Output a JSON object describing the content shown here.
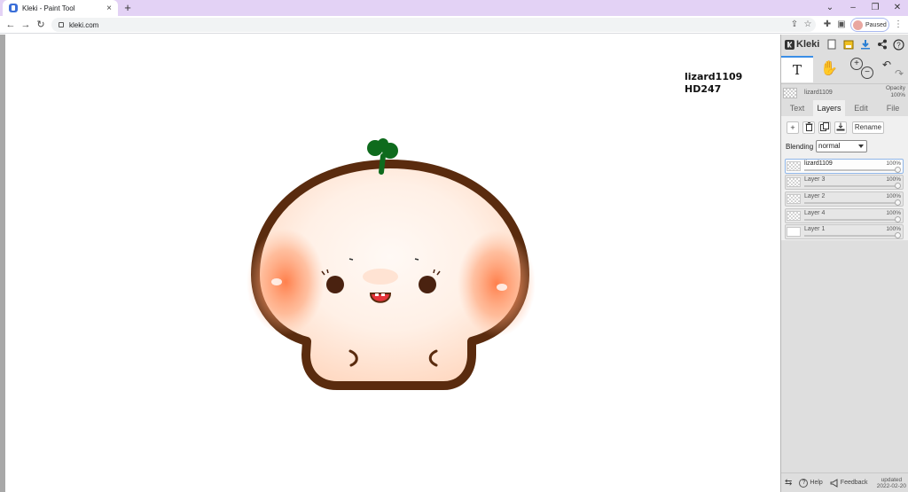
{
  "browser": {
    "tab_title": "Kleki - Paint Tool",
    "tab_close": "×",
    "new_tab": "+",
    "url": "kleki.com",
    "profile_status": "Paused",
    "window_controls": {
      "collapse": "⌄",
      "minimize": "–",
      "restore": "❐",
      "close": "✕"
    },
    "nav": {
      "back": "←",
      "forward": "→",
      "reload": "↻"
    },
    "address_icons": {
      "share": "⇪",
      "bookmark": "☆",
      "extensions": "✚",
      "sidepanel": "▣",
      "menu": "⋮"
    }
  },
  "canvas": {
    "signature_line1": "lizard1109",
    "signature_line2": "HD247"
  },
  "kleki": {
    "logo": "Kleki",
    "top_icons": {
      "new": "new-image-icon",
      "save": "save-icon",
      "download": "download-icon",
      "share": "share-icon",
      "help": "help-icon"
    },
    "tools": {
      "text_label": "T",
      "hand": "✋",
      "zoom_in": "+",
      "zoom_out": "−",
      "undo": "↶",
      "redo": "↷"
    },
    "current_layer": {
      "name": "lizard1109",
      "opacity_label": "Opacity",
      "opacity_value": "100%"
    },
    "tabs": [
      {
        "label": "Text"
      },
      {
        "label": "Layers"
      },
      {
        "label": "Edit"
      },
      {
        "label": "File"
      }
    ],
    "active_tab": "Layers",
    "layer_buttons": {
      "add": "+",
      "delete": "🗑",
      "duplicate": "⧉",
      "merge": "⤓",
      "rename": "Rename"
    },
    "blending_label": "Blending",
    "blending_value": "normal",
    "layers": [
      {
        "name": "lizard1109",
        "opacity": "100%",
        "selected": true
      },
      {
        "name": "Layer 3",
        "opacity": "100%",
        "selected": false
      },
      {
        "name": "Layer 2",
        "opacity": "100%",
        "selected": false
      },
      {
        "name": "Layer 4",
        "opacity": "100%",
        "selected": false
      },
      {
        "name": "Layer 1",
        "opacity": "100%",
        "selected": false
      }
    ],
    "bottom": {
      "swap": "⇆",
      "help_label": "Help",
      "feedback_label": "Feedback",
      "updated_label": "updated",
      "updated_date": "2022-02-20"
    }
  },
  "colors": {
    "outline": "#5a2b0e",
    "sprout": "#0e6b1d",
    "blush": "#ff8a55",
    "accent": "#3a8ee6"
  }
}
